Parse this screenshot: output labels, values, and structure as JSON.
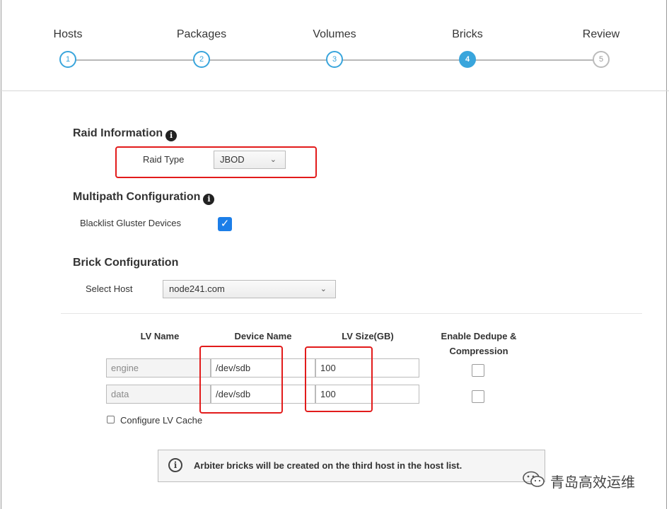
{
  "wizard": {
    "steps": [
      {
        "label": "Hosts",
        "number": "1",
        "state": "done"
      },
      {
        "label": "Packages",
        "number": "2",
        "state": "done"
      },
      {
        "label": "Volumes",
        "number": "3",
        "state": "done"
      },
      {
        "label": "Bricks",
        "number": "4",
        "state": "active"
      },
      {
        "label": "Review",
        "number": "5",
        "state": "pending"
      }
    ]
  },
  "raid": {
    "heading": "Raid Information",
    "type_label": "Raid Type",
    "type_value": "JBOD"
  },
  "multipath": {
    "heading": "Multipath Configuration",
    "blacklist_label": "Blacklist Gluster Devices",
    "blacklist_checked": true
  },
  "brick": {
    "heading": "Brick Configuration",
    "host_label": "Select Host",
    "host_value": "node241.com",
    "table": {
      "headers": {
        "lv_name": "LV Name",
        "device_name": "Device Name",
        "lv_size": "LV Size(GB)",
        "dedupe_line1": "Enable Dedupe &",
        "dedupe_line2": "Compression"
      },
      "rows": [
        {
          "lv_name": "engine",
          "device": "/dev/sdb",
          "size": "100",
          "dedupe": false
        },
        {
          "lv_name": "data",
          "device": "/dev/sdb",
          "size": "100",
          "dedupe": false
        }
      ]
    },
    "lv_cache_label": "Configure LV Cache"
  },
  "alert": {
    "icon": "info-circle-icon",
    "text": "Arbiter bricks will be created on the third host in the host list."
  },
  "watermark": {
    "text": "青岛高效运维"
  },
  "colors": {
    "accent": "#39a5dc",
    "checkbox": "#1c7ee8",
    "highlight": "#e21b1b"
  }
}
